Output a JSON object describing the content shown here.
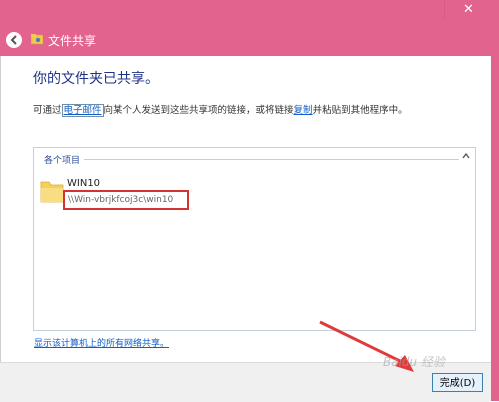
{
  "window": {
    "title": "文件共享",
    "close_label": "✕"
  },
  "main": {
    "heading": "你的文件夹已共享。",
    "desc_prefix": "可通过",
    "email_link": "电子邮件",
    "desc_middle": "向某个人发送到这些共享项的链接，或将链接",
    "copy_link": "复制",
    "desc_suffix": "并粘贴到其他程序中。"
  },
  "list": {
    "group_label": "各个项目",
    "items": [
      {
        "name": "WIN10",
        "path": "\\\\Win-vbrjkfcoj3c\\win10"
      }
    ]
  },
  "footer": {
    "show_all_link": "显示该计算机上的所有网络共享。",
    "done_button": "完成(D)"
  },
  "colors": {
    "titlebar": "#e3638f",
    "heading": "#1e3287",
    "link": "#0f5ec9",
    "highlight": "#d33333"
  },
  "watermark": "Baidu 经验"
}
